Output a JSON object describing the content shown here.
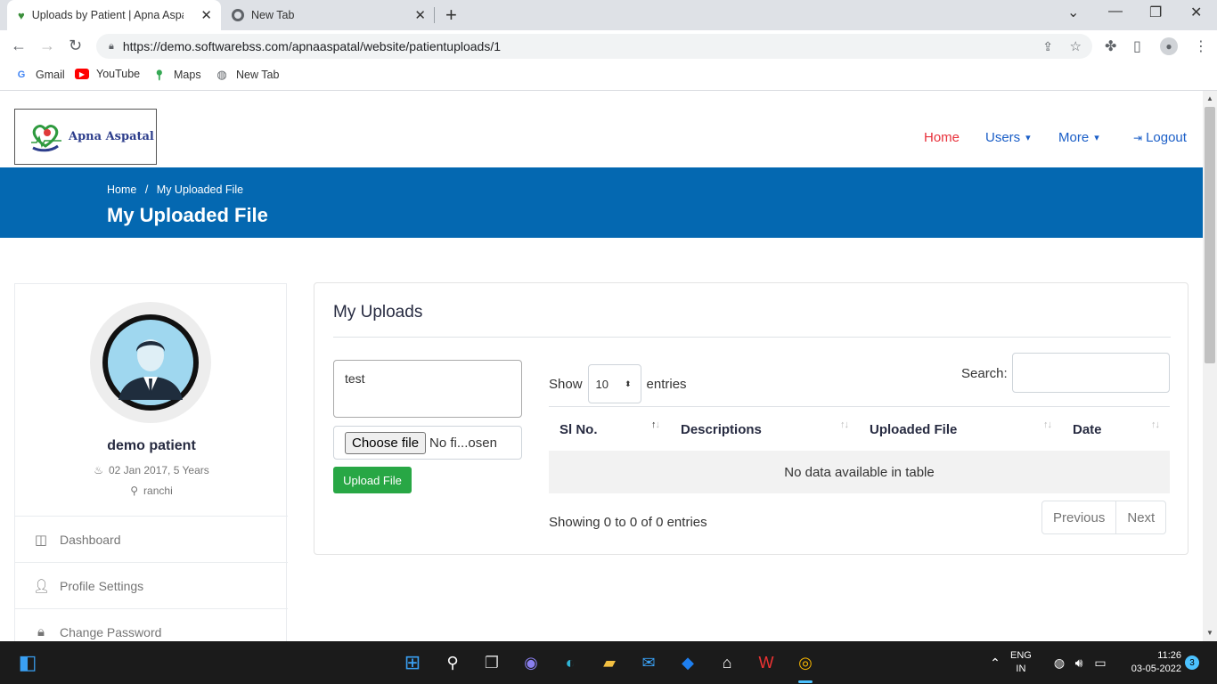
{
  "browser": {
    "tabs": [
      {
        "title": "Uploads by Patient | Apna Aspatal",
        "active": true
      },
      {
        "title": "New Tab",
        "active": false
      }
    ],
    "url": "https://demo.softwarebss.com/apnaaspatal/website/patientuploads/1",
    "bookmarks": [
      "Gmail",
      "YouTube",
      "Maps",
      "New Tab"
    ]
  },
  "site": {
    "logo_text": "Apna Aspatal",
    "nav": {
      "home": "Home",
      "users": "Users",
      "more": "More",
      "logout": "Logout"
    },
    "accent_color": "#0468b1",
    "nav_active_color": "#e8313b"
  },
  "banner": {
    "breadcrumb_home": "Home",
    "breadcrumb_sep": "/",
    "breadcrumb_current": "My Uploaded File",
    "title": "My Uploaded File"
  },
  "profile": {
    "name": "demo patient",
    "dob": "02 Jan 2017, 5 Years",
    "location": "ranchi",
    "menu": [
      {
        "label": "Dashboard",
        "icon": "columns-icon"
      },
      {
        "label": "Profile Settings",
        "icon": "user-cog-icon"
      },
      {
        "label": "Change Password",
        "icon": "lock-icon"
      }
    ]
  },
  "uploads": {
    "card_title": "My Uploads",
    "description_value": "test",
    "choose_file_label": "Choose file",
    "file_name": "No fi...osen",
    "upload_button": "Upload File"
  },
  "table": {
    "show_label": "Show",
    "entries_label": "entries",
    "page_length": "10",
    "search_label": "Search:",
    "columns": [
      "Sl No.",
      "Descriptions",
      "Uploaded File",
      "Date"
    ],
    "empty_message": "No data available in table",
    "info": "Showing 0 to 0 of 0 entries",
    "prev_label": "Previous",
    "next_label": "Next"
  },
  "taskbar": {
    "language": "ENG",
    "region": "IN",
    "time": "11:26",
    "date": "03-05-2022",
    "notification_count": "3"
  }
}
